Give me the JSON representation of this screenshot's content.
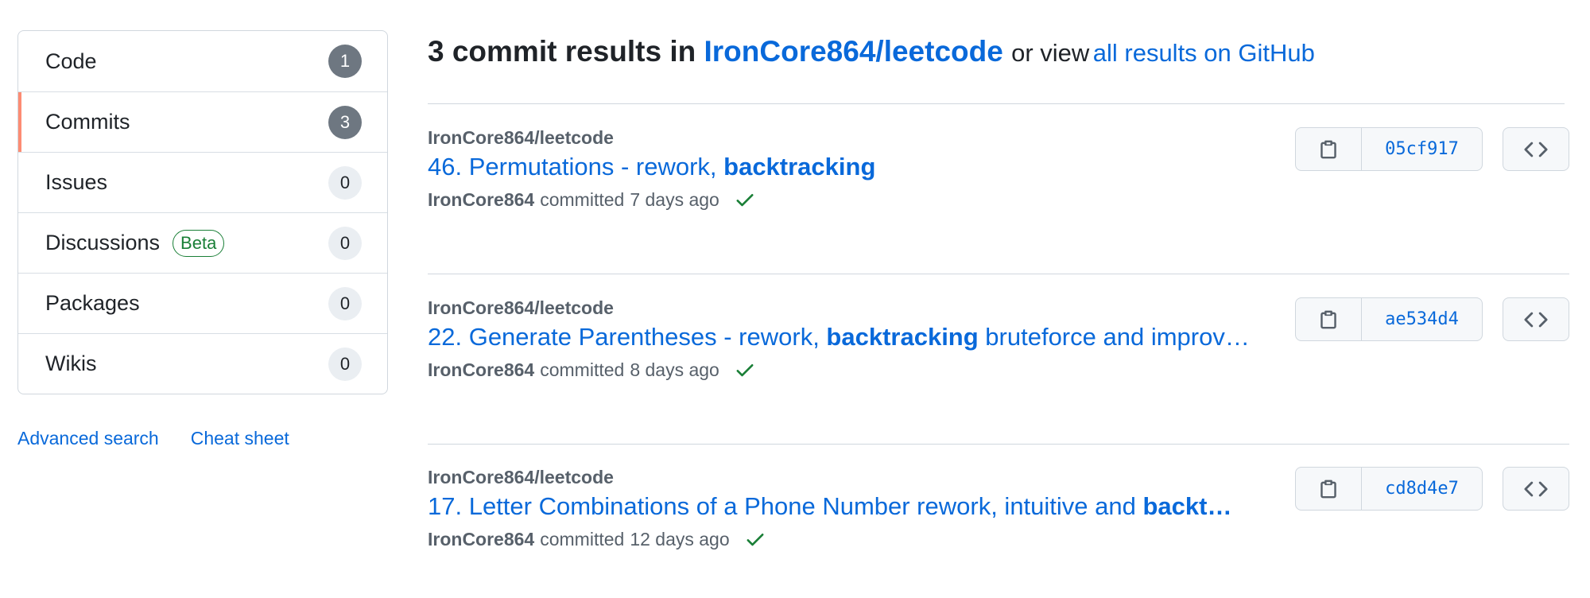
{
  "sidebar": {
    "items": [
      {
        "label": "Code",
        "count": "1"
      },
      {
        "label": "Commits",
        "count": "3"
      },
      {
        "label": "Issues",
        "count": "0"
      },
      {
        "label": "Discussions",
        "count": "0",
        "badge": "Beta"
      },
      {
        "label": "Packages",
        "count": "0"
      },
      {
        "label": "Wikis",
        "count": "0"
      }
    ],
    "selected": "Commits",
    "links": {
      "advanced_search": "Advanced search",
      "cheat_sheet": "Cheat sheet"
    }
  },
  "header": {
    "count_text": "3 commit results in",
    "repo": "IronCore864/leetcode",
    "or_view": "or view",
    "all_results": "all results on GitHub"
  },
  "commits": [
    {
      "repo": "IronCore864/leetcode",
      "title_plain": "46. Permutations - rework, ",
      "title_bold": "backtracking",
      "title_after": "",
      "author": "IronCore864",
      "verb": "committed",
      "time": "7 days ago",
      "sha": "05cf917"
    },
    {
      "repo": "IronCore864/leetcode",
      "title_plain": "22. Generate Parentheses - rework, ",
      "title_bold": "backtracking",
      "title_after": " bruteforce and improv…",
      "author": "IronCore864",
      "verb": "committed",
      "time": "8 days ago",
      "sha": "ae534d4"
    },
    {
      "repo": "IronCore864/leetcode",
      "title_plain": "17. Letter Combinations of a Phone Number rework, intuitive and ",
      "title_bold": "backt…",
      "title_after": "",
      "author": "IronCore864",
      "verb": "committed",
      "time": "12 days ago",
      "sha": "cd8d4e7"
    }
  ],
  "icons": {
    "copy": "clipboard-icon",
    "browse": "code-icon",
    "status": "check-icon"
  },
  "colors": {
    "link": "#0969da",
    "selected_accent": "#fd8c73",
    "success": "#1a7f37",
    "counter_primary_bg": "#6e7781",
    "counter_bg": "#eaeef2",
    "muted_text": "#57606a"
  }
}
